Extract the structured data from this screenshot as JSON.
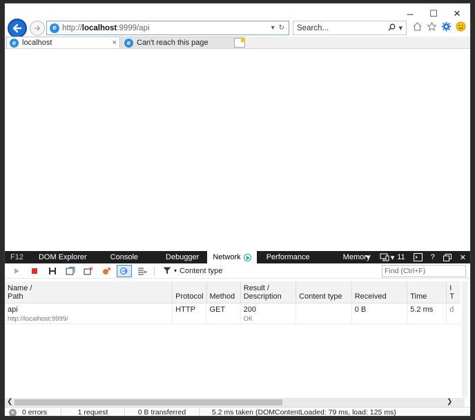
{
  "titlebar": {
    "minimize": "─",
    "maximize": "☐",
    "close": "✕"
  },
  "address": {
    "prefix": "http://",
    "host": "localhost",
    "rest": ":9999/api"
  },
  "search": {
    "placeholder": "Search..."
  },
  "tabs": [
    {
      "label": "localhost",
      "close": "×"
    },
    {
      "label": "Can't reach this page"
    }
  ],
  "devtools": {
    "f12": "F12",
    "tabs": [
      "DOM Explorer",
      "Console",
      "Debugger",
      "Network",
      "Performance",
      "Memory"
    ],
    "emulation_count": "11",
    "right_icons": {
      "help": "?",
      "close": "✕"
    },
    "filter_label": "Content type",
    "find_placeholder": "Find (Ctrl+F)",
    "columns": [
      "Name /\nPath",
      "Protocol",
      "Method",
      "Result /\nDescription",
      "Content type",
      "Received",
      "Time",
      "I\nT"
    ],
    "rows": [
      {
        "name": "api",
        "path": "http://localhost:9999/",
        "protocol": "HTTP",
        "method": "GET",
        "result": "200",
        "description": "OK",
        "content_type": "",
        "received": "0 B",
        "time": "5.2 ms",
        "extra": "d"
      }
    ],
    "status": {
      "errors": "0 errors",
      "requests": "1 request",
      "transferred": "0 B transferred",
      "timing": "5.2 ms taken (DOMContentLoaded: 79 ms, load: 125 ms)"
    }
  },
  "colors": {
    "accent": "#1d6fd1",
    "devtools_bg": "#1f1f1f"
  }
}
